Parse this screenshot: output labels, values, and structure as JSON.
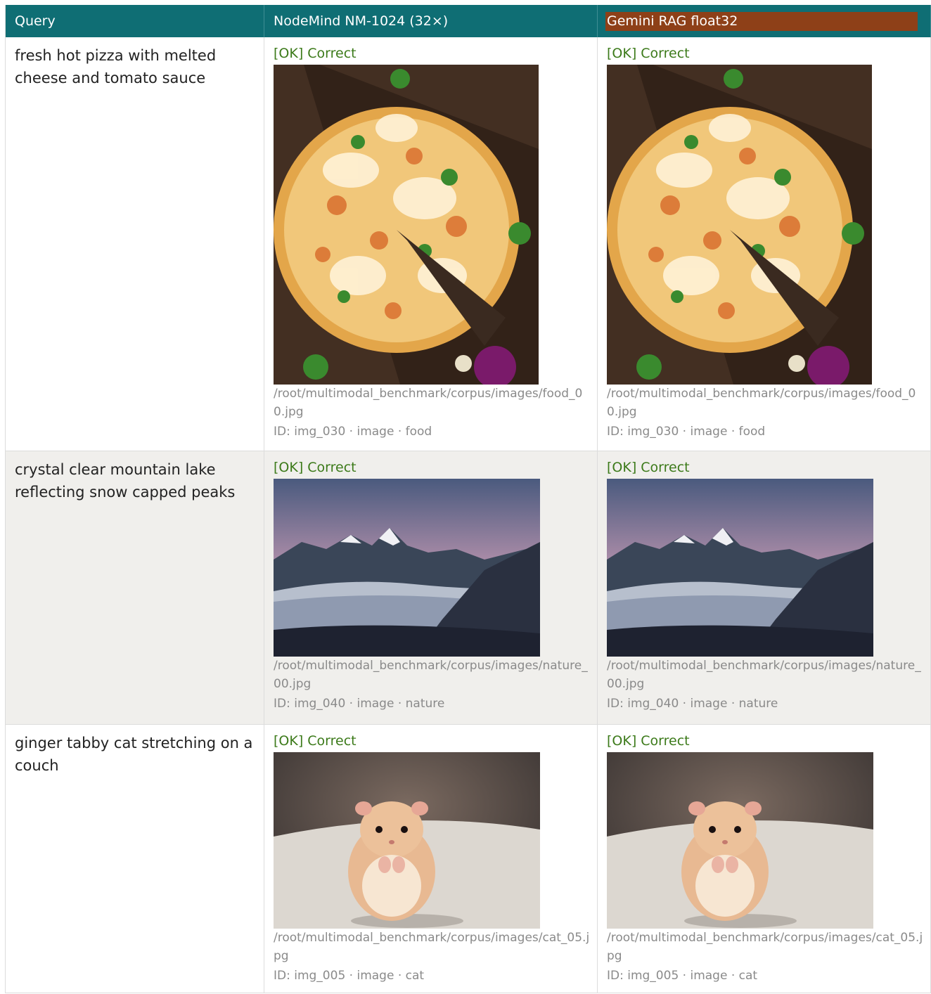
{
  "table": {
    "headers": {
      "query": "Query",
      "model_a": "NodeMind NM-1024 (32×)",
      "model_b": "Gemini RAG float32"
    },
    "rows": [
      {
        "query": "fresh hot pizza with melted cheese and tomato sauce",
        "a": {
          "status": "[OK] Correct",
          "path": "/root/multimodal_benchmark/corpus/images/food_00.jpg",
          "meta": "ID: img_030 · image · food"
        },
        "b": {
          "status": "[OK] Correct",
          "path": "/root/multimodal_benchmark/corpus/images/food_00.jpg",
          "meta": "ID: img_030 · image · food"
        }
      },
      {
        "query": "crystal clear mountain lake reflecting snow capped peaks",
        "a": {
          "status": "[OK] Correct",
          "path": "/root/multimodal_benchmark/corpus/images/nature_00.jpg",
          "meta": "ID: img_040 · image · nature"
        },
        "b": {
          "status": "[OK] Correct",
          "path": "/root/multimodal_benchmark/corpus/images/nature_00.jpg",
          "meta": "ID: img_040 · image · nature"
        }
      },
      {
        "query": "ginger tabby cat stretching on a couch",
        "a": {
          "status": "[OK] Correct",
          "path": "/root/multimodal_benchmark/corpus/images/cat_05.jpg",
          "meta": "ID: img_005 · image · cat"
        },
        "b": {
          "status": "[OK] Correct",
          "path": "/root/multimodal_benchmark/corpus/images/cat_05.jpg",
          "meta": "ID: img_005 · image · cat"
        }
      }
    ]
  },
  "colors": {
    "header_bg": "#0f6e74",
    "highlight_bg": "#8e4018",
    "ok_text": "#3c7a1a",
    "alt_row_bg": "#f0efec"
  }
}
